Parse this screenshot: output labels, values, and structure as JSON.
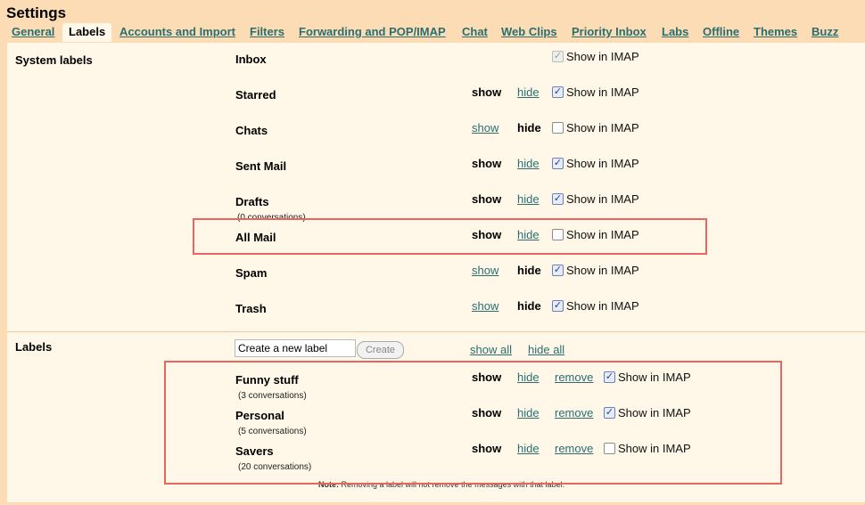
{
  "page": {
    "title": "Settings"
  },
  "tabs": [
    {
      "label": "General"
    },
    {
      "label": "Labels"
    },
    {
      "label": "Accounts and Import"
    },
    {
      "label": "Filters"
    },
    {
      "label": "Forwarding and POP/IMAP"
    },
    {
      "label": "Chat"
    },
    {
      "label": "Web Clips"
    },
    {
      "label": "Priority Inbox"
    },
    {
      "label": "Labs"
    },
    {
      "label": "Offline"
    },
    {
      "label": "Themes"
    },
    {
      "label": "Buzz"
    }
  ],
  "system_labels": {
    "section_title": "System labels",
    "show_text": "show",
    "hide_text": "hide",
    "imap_text": "Show in IMAP",
    "rows": [
      {
        "name": "Inbox",
        "visibility": "none",
        "imap_checked": true,
        "imap_disabled": true
      },
      {
        "name": "Starred",
        "visibility": "shown",
        "imap_checked": true
      },
      {
        "name": "Chats",
        "visibility": "hidden",
        "imap_checked": false
      },
      {
        "name": "Sent Mail",
        "visibility": "shown",
        "imap_checked": true
      },
      {
        "name": "Drafts",
        "sub": "(0 conversations)",
        "visibility": "shown",
        "imap_checked": true
      },
      {
        "name": "All Mail",
        "visibility": "shown",
        "imap_checked": false
      },
      {
        "name": "Spam",
        "visibility": "hidden",
        "imap_checked": true
      },
      {
        "name": "Trash",
        "visibility": "hidden",
        "imap_checked": true
      }
    ]
  },
  "labels": {
    "section_title": "Labels",
    "new_label_value": "Create a new label",
    "create_button": "Create",
    "show_all": "show all",
    "hide_all": "hide all",
    "show_text": "show",
    "hide_text": "hide",
    "remove_text": "remove",
    "imap_text": "Show in IMAP",
    "rows": [
      {
        "name": "Funny stuff",
        "sub": "(3 conversations)",
        "visibility": "shown",
        "imap_checked": true
      },
      {
        "name": "Personal",
        "sub": "(5 conversations)",
        "visibility": "shown",
        "imap_checked": true
      },
      {
        "name": "Savers",
        "sub": "(20 conversations)",
        "visibility": "shown",
        "imap_checked": false
      }
    ],
    "note_bold": "Note:",
    "note_text": " Removing a label will not remove the messages with that label."
  },
  "colors": {
    "link": "#2a6e70",
    "highlight": "#e8665f",
    "panel": "#fff8e8",
    "page": "#fcdcb4"
  }
}
